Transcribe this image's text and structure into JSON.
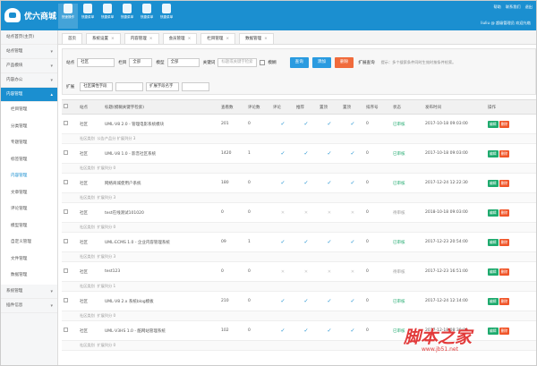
{
  "header": {
    "logo_text": "优六商城",
    "nav": [
      "快速操作",
      "快捷菜单",
      "快捷菜单",
      "快捷菜单",
      "快捷菜单",
      "快捷菜单"
    ],
    "links": [
      "帮助",
      "联系我们",
      "退出"
    ],
    "user": "liuliu @ 超级管理员  欢迎光临"
  },
  "sidebar": {
    "top_items": [
      "站点首页(主页)",
      "站点管理",
      "产品模块",
      "内容办公"
    ],
    "active": "内容管理",
    "subitems": [
      "栏目管理",
      "分类管理",
      "专题管理",
      "标签管理",
      "内容管理",
      "文章管理",
      "评论管理",
      "模型管理",
      "自定义管理",
      "文件管理",
      "数据管理"
    ],
    "bottom_items": [
      "系统管理",
      "插件信息"
    ]
  },
  "tabs": [
    "首页",
    "系统设置",
    "内容管理",
    "会员管理",
    "栏目管理",
    "数据管理"
  ],
  "filter": {
    "site_label": "站点",
    "site_value": "社区",
    "cat_label": "栏目",
    "cat_value": "全部",
    "model_label": "模型",
    "model_value": "全部",
    "keyword_label": "关键词",
    "keyword_placeholder": "标题或关键字检索",
    "check_label": "模糊",
    "search_label": "查询",
    "add_label": "添加",
    "delete_label": "删除",
    "ext_toggle": "扩展查询",
    "hint": "提示：多个搜索条件同时生效时按条件检索。",
    "ext_label": "扩展",
    "ext_field1": "社区属性字段",
    "ext_field2": "扩展字段名字"
  },
  "table": {
    "headers": [
      "",
      "站点",
      "标题(模糊关键字检索)",
      "查看数",
      "评论数",
      "评论",
      "推荐",
      "置顶",
      "置顶",
      "排序号",
      "状态",
      "发布时间",
      "操作"
    ],
    "sub_prefix": "社区类别",
    "sub_text": "公告产品分",
    "sub_ext": "扩展列分",
    "edit": "编辑",
    "del": "删除",
    "rows": [
      {
        "site": "社区",
        "title": "UML·V8 2.0 - 管理电影系统模块",
        "views": "201",
        "c": "0",
        "a": "yes",
        "b": "yes",
        "d": "yes",
        "e": "yes",
        "sort": "0",
        "status": "已审核",
        "status_on": true,
        "time": "2017-10-18 09:03:00",
        "sub": "公告产品分 扩展列分 3"
      },
      {
        "site": "社区",
        "title": "UML·V8 1.0 - 影音社区系统",
        "views": "1420",
        "c": "1",
        "a": "yes",
        "b": "yes",
        "d": "yes",
        "e": "yes",
        "sort": "0",
        "status": "已审核",
        "status_on": true,
        "time": "2017-10-18 09:03:00",
        "sub": "扩展列分 0"
      },
      {
        "site": "社区",
        "title": "网络商城使用户系统",
        "views": "180",
        "c": "0",
        "a": "yes",
        "b": "yes",
        "d": "yes",
        "e": "yes",
        "sort": "0",
        "status": "已审核",
        "status_on": true,
        "time": "2017-12-24 12:22:30",
        "sub": "扩展列分 3"
      },
      {
        "site": "社区",
        "title": "test在线测试101020",
        "views": "0",
        "c": "0",
        "a": "no",
        "b": "no",
        "d": "no",
        "e": "no",
        "sort": "0",
        "status": "待审核",
        "status_on": false,
        "time": "2018-10-18 09:03:00",
        "sub": "扩展列分 0"
      },
      {
        "site": "社区",
        "title": "UML·ECMS 1.0 - 企业内容管理系统",
        "views": "09",
        "c": "1",
        "a": "yes",
        "b": "yes",
        "d": "yes",
        "e": "yes",
        "sort": "0",
        "status": "已审核",
        "status_on": true,
        "time": "2017-12-23 20:54:00",
        "sub": "扩展列分 3"
      },
      {
        "site": "社区",
        "title": "test123",
        "views": "0",
        "c": "0",
        "a": "no",
        "b": "no",
        "d": "no",
        "e": "no",
        "sort": "0",
        "status": "待审核",
        "status_on": false,
        "time": "2017-12-23 16:51:00",
        "sub": "扩展列分 1"
      },
      {
        "site": "社区",
        "title": "UML·V8 2.x 系统blog模板",
        "views": "210",
        "c": "0",
        "a": "yes",
        "b": "yes",
        "d": "yes",
        "e": "yes",
        "sort": "0",
        "status": "已审核",
        "status_on": true,
        "time": "2017-12-24 12:14:00",
        "sub": "扩展列分 0"
      },
      {
        "site": "社区",
        "title": "UML·V3HS 1.0 - 酷网站管理系统",
        "views": "102",
        "c": "0",
        "a": "yes",
        "b": "yes",
        "d": "yes",
        "e": "yes",
        "sort": "0",
        "status": "已审核",
        "status_on": true,
        "time": "2017-12-18 08:30:00",
        "sub": "扩展列分 0"
      }
    ]
  },
  "watermark": {
    "cn": "脚本之家",
    "url": "www.jb51.net"
  }
}
